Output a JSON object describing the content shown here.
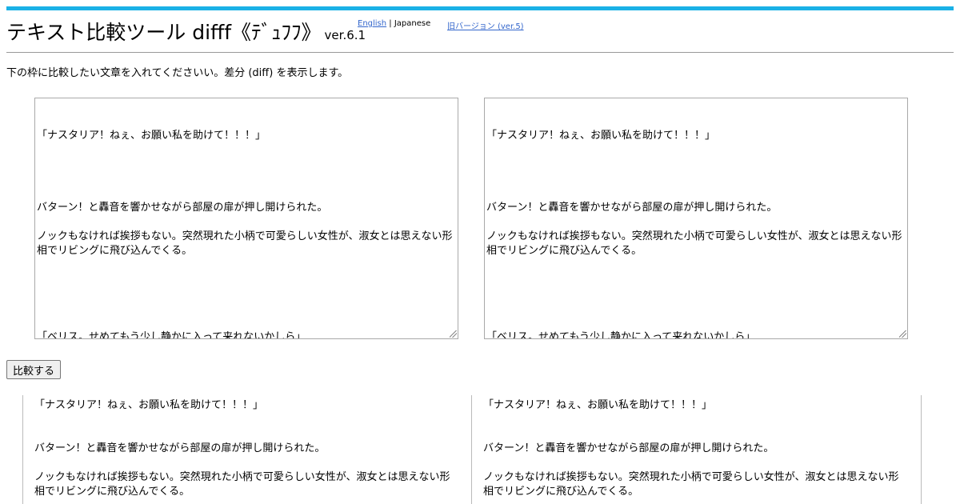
{
  "header": {
    "title": "テキスト比較ツール difff《ﾃﾞｭﾌﾌ》",
    "version": "ver.6.1",
    "lang_english": "English",
    "lang_separator": "|",
    "lang_japanese": "Japanese",
    "old_version_link": "旧バージョン (ver.5)"
  },
  "intro": "下の枠に比較したい文章を入れてくださいい。差分 (diff) を表示します。",
  "inputs": {
    "left_lines": [
      "「ナスタリア！ねぇ、お願い私を助けて！！！」",
      "",
      "",
      "",
      "",
      "バターン！と轟音を響かせながら部屋の扉が押し開けられた。",
      "",
      "ノックもなければ挨拶もない。突然現れた小柄で可愛らしい女性が、淑女とは思えない形相でリビングに飛び込んでくる。",
      "",
      "",
      "",
      "",
      "",
      "「ベリス。せめてもう少し静かに入って来れないかしら」"
    ],
    "right_lines": [
      "「ナスタリア！ねぇ、お願い私を助けて！！！」",
      "",
      "",
      "",
      "",
      "バターン！と轟音を響かせながら部屋の扉が押し開けられた。",
      "",
      "ノックもなければ挨拶もない。突然現れた小柄で可愛らしい女性が、淑女とは思えない形相でリビングに飛び込んでくる。",
      "",
      "",
      "",
      "",
      "",
      "「ベリス。せめてもう少し静かに入って来れないかしら」"
    ]
  },
  "compare_button": "比較する",
  "results": {
    "left_lines": [
      "「ナスタリア！ねぇ、お願い私を助けて！！！」",
      "",
      "",
      "バターン！と轟音を響かせながら部屋の扉が押し開けられた。",
      "",
      "ノックもなければ挨拶もない。突然現れた小柄で可愛らしい女性が、淑女とは思えない形相でリビングに飛び込んでくる。"
    ],
    "right_lines": [
      "「ナスタリア！ねぇ、お願い私を助けて！！！」",
      "",
      "",
      "バターン！と轟音を響かせながら部屋の扉が押し開けられた。",
      "",
      "ノックもなければ挨拶もない。突然現れた小柄で可愛らしい女性が、淑女とは思えない形相でリビングに飛び込んでくる。"
    ]
  },
  "colors": {
    "accent_bar": "#1ab1e6",
    "link": "#3366cc"
  }
}
